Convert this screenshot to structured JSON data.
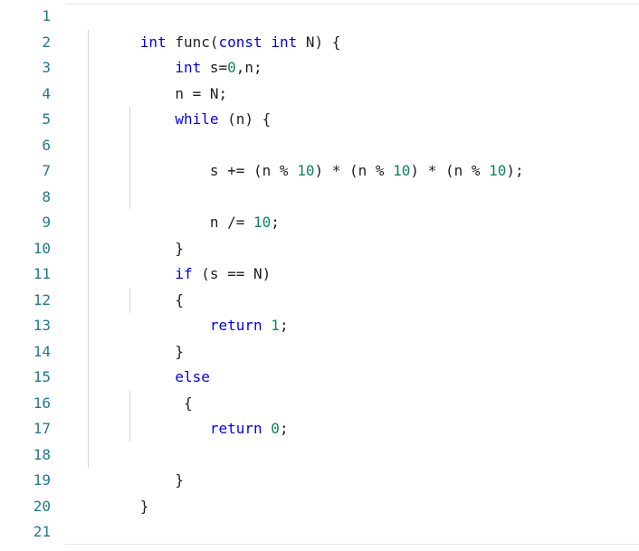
{
  "colors": {
    "line_number": "#237893",
    "keyword": "#0000ff",
    "number": "#098658",
    "text": "#1f1f1f",
    "indent_guide": "#d3d3d3"
  },
  "line_numbers": [
    "1",
    "2",
    "3",
    "4",
    "5",
    "6",
    "7",
    "8",
    "9",
    "10",
    "11",
    "12",
    "13",
    "14",
    "15",
    "16",
    "17",
    "18",
    "19",
    "20",
    "21"
  ],
  "code": {
    "l1": [
      "int",
      " func(",
      "const",
      " ",
      "int",
      " N) {"
    ],
    "l2": [
      "    ",
      "int",
      " s=",
      "0",
      ",n;"
    ],
    "l3": [
      "    n = N;"
    ],
    "l4": [
      "    ",
      "while",
      " (n) {"
    ],
    "l6": [
      "        s += (n % ",
      "10",
      ") * (n % ",
      "10",
      ") * (n % ",
      "10",
      ");"
    ],
    "l8": [
      "        n /= ",
      "10",
      ";"
    ],
    "l9": [
      "    }"
    ],
    "l10": [
      "    ",
      "if",
      " (s == N)"
    ],
    "l11": [
      "    {"
    ],
    "l12": [
      "        ",
      "return",
      " ",
      "1",
      ";"
    ],
    "l13": [
      "    }"
    ],
    "l14": [
      "    ",
      "else"
    ],
    "l15": [
      "     {"
    ],
    "l16": [
      "        ",
      "return",
      " ",
      "0",
      ";"
    ],
    "l18": [
      "    }"
    ],
    "l19": [
      "}"
    ]
  }
}
